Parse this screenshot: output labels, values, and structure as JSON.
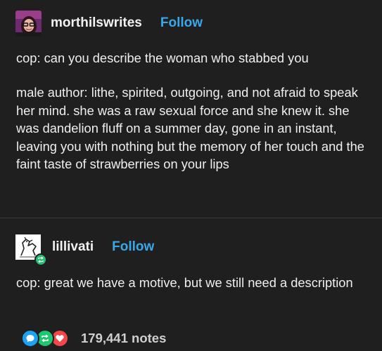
{
  "post": {
    "author": {
      "username": "morthilswrites",
      "follow_label": "Follow",
      "avatar_icon": "avatar-woman-glasses"
    },
    "body": {
      "line1": "cop: can you describe the woman who stabbed you",
      "line2": "male author: lithe, spirited, outgoing, and not afraid to speak her mind. she was a raw sexual force and she knew it. she was dandelion fluff on a summer day, gone in an instant, leaving you with nothing but the memory of her touch and the faint taste of strawberries on your lips"
    }
  },
  "reblog": {
    "author": {
      "username": "lillivati",
      "follow_label": "Follow",
      "avatar_icon": "avatar-bird-drawing",
      "badge_icon": "reblog-icon"
    },
    "body": {
      "line1": "cop: great we have a motive, but we still need a description"
    }
  },
  "notes": {
    "count_label": "179,441 notes",
    "icons": [
      "comment-icon",
      "reblog-icon",
      "heart-icon"
    ]
  },
  "colors": {
    "background": "#1f1f1f",
    "accent": "#3aa7e8",
    "text": "#efefef"
  }
}
